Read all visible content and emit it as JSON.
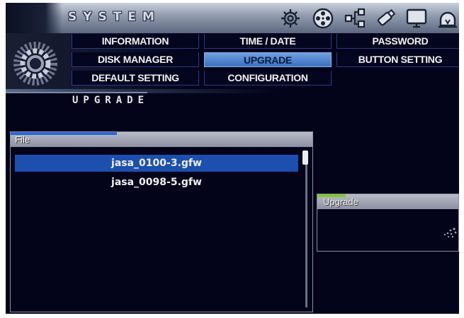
{
  "header": {
    "title": "SYSTEM",
    "icons": [
      "gear-icon",
      "film-reel-icon",
      "network-icon",
      "usb-icon",
      "monitor-icon",
      "alarm-icon"
    ]
  },
  "tabs": [
    {
      "label": "INFORMATION",
      "active": false
    },
    {
      "label": "TIME / DATE",
      "active": false
    },
    {
      "label": "PASSWORD",
      "active": false
    },
    {
      "label": "DISK MANAGER",
      "active": false
    },
    {
      "label": "UPGRADE",
      "active": true
    },
    {
      "label": "BUTTON SETTING",
      "active": false
    },
    {
      "label": "DEFAULT SETTING",
      "active": false
    },
    {
      "label": "CONFIGURATION",
      "active": false
    }
  ],
  "page_title": "UPGRADE",
  "file_panel": {
    "header": "File",
    "files": [
      "jasa_0100-3.gfw",
      "jasa_0098-5.gfw"
    ],
    "selected_index": 0
  },
  "upgrade_panel": {
    "header": "Upgrade"
  },
  "colors": {
    "background": "#03031a",
    "selection": "#1c4fae",
    "active_tab": "#5a8fd8",
    "tab_border": "#2c3a88",
    "upgrade_accent": "#7ec92a",
    "file_accent": "#2a66d8"
  }
}
